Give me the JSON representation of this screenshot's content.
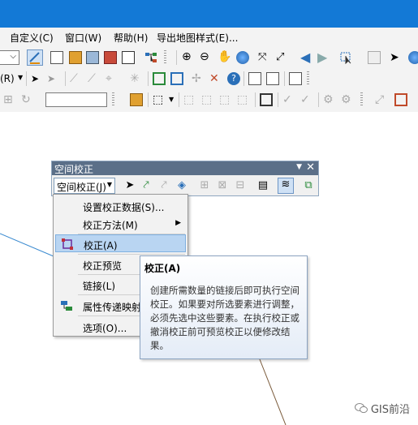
{
  "menubar": {
    "items": [
      "自定义(C)",
      "窗口(W)",
      "帮助(H)",
      "导出地图样式(E)..."
    ]
  },
  "toolbar": {
    "row2_prefix": "(R)",
    "accent_color": "#1379d6"
  },
  "spatial_adjustment": {
    "title": "空间校正",
    "menu_button": "空间校正(J)"
  },
  "dropdown": {
    "items": [
      {
        "label": "设置校正数据(S)..."
      },
      {
        "label": "校正方法(M)"
      },
      {
        "label": "校正(A)"
      },
      {
        "label": "校正预览"
      },
      {
        "label": "链接(L)"
      },
      {
        "label": "属性传递映射"
      },
      {
        "label": "选项(O)..."
      }
    ]
  },
  "tooltip": {
    "title": "校正(A)",
    "body": "创建所需数量的链接后即可执行空间校正。如果要对所选要素进行调整，必须先选中这些要素。在执行校正或撤消校正前可预览校正以便修改结果。"
  },
  "watermark": {
    "text": "GIS前沿"
  }
}
